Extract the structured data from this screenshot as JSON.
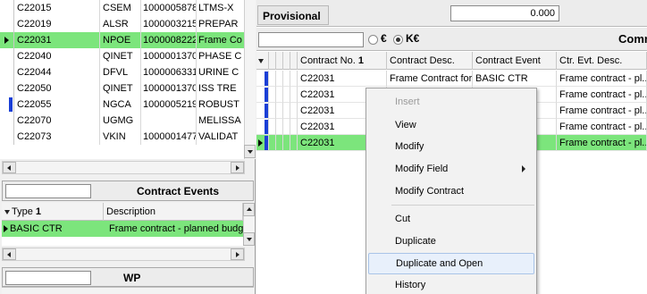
{
  "contracts_table": {
    "rows": [
      {
        "contract": "C22015",
        "code": "CSEM",
        "number": "1000005878",
        "desc": "LTMS-X"
      },
      {
        "contract": "C22019",
        "code": "ALSR",
        "number": "1000003215",
        "desc": "PREPAR"
      },
      {
        "contract": "C22031",
        "code": "NPOE",
        "number": "1000008222",
        "desc": "Frame Co"
      },
      {
        "contract": "C22040",
        "code": "QINET",
        "number": "1000001370",
        "desc": "PHASE C"
      },
      {
        "contract": "C22044",
        "code": "DFVL",
        "number": "1000006331",
        "desc": "URINE C"
      },
      {
        "contract": "C22050",
        "code": "QINET",
        "number": "1000001370",
        "desc": "ISS TRE"
      },
      {
        "contract": "C22055",
        "code": "NGCA",
        "number": "1000005219",
        "desc": "ROBUST"
      },
      {
        "contract": "C22070",
        "code": "UGMG",
        "number": "",
        "desc": "MELISSA"
      },
      {
        "contract": "C22073",
        "code": "VKIN",
        "number": "1000001477",
        "desc": "VALIDAT"
      }
    ]
  },
  "contract_events": {
    "title": "Contract Events",
    "columns": {
      "type": "Type",
      "type_sort": "1",
      "description": "Description"
    },
    "rows": [
      {
        "type": "BASIC CTR",
        "description": "Frame contract - planned budge"
      }
    ]
  },
  "wp": {
    "title": "WP"
  },
  "provisional": {
    "label": "Provisional",
    "value": "0.000"
  },
  "currency": {
    "euro_symbol": "€",
    "keuro_label": "K€",
    "comm_label": "Comn"
  },
  "events_grid": {
    "columns": {
      "contract_no": "Contract No.",
      "contract_no_sort": "1",
      "contract_desc": "Contract Desc.",
      "contract_event": "Contract Event",
      "ctr_evt_desc": "Ctr. Evt. Desc."
    },
    "rows": [
      {
        "contract_no": "C22031",
        "contract_desc": "Frame Contract for...",
        "contract_event": "BASIC CTR",
        "ctr_evt_desc": "Frame contract - pl..."
      },
      {
        "contract_no": "C22031",
        "contract_desc": "",
        "contract_event": "",
        "ctr_evt_desc": "Frame contract - pl..."
      },
      {
        "contract_no": "C22031",
        "contract_desc": "",
        "contract_event": "",
        "ctr_evt_desc": "Frame contract - pl..."
      },
      {
        "contract_no": "C22031",
        "contract_desc": "",
        "contract_event": "",
        "ctr_evt_desc": "Frame contract - pl..."
      },
      {
        "contract_no": "C22031",
        "contract_desc": "",
        "contract_event": "",
        "ctr_evt_desc": "Frame contract - pl..."
      }
    ]
  },
  "context_menu": {
    "items": [
      "Insert",
      "View",
      "Modify",
      "Modify Field",
      "Modify Contract",
      "Cut",
      "Duplicate",
      "Duplicate and Open",
      "History"
    ]
  },
  "colors": {
    "selection": "#7ce57c",
    "indicator": "#1a3fd6",
    "menu_highlight": "#e8f0fb"
  }
}
